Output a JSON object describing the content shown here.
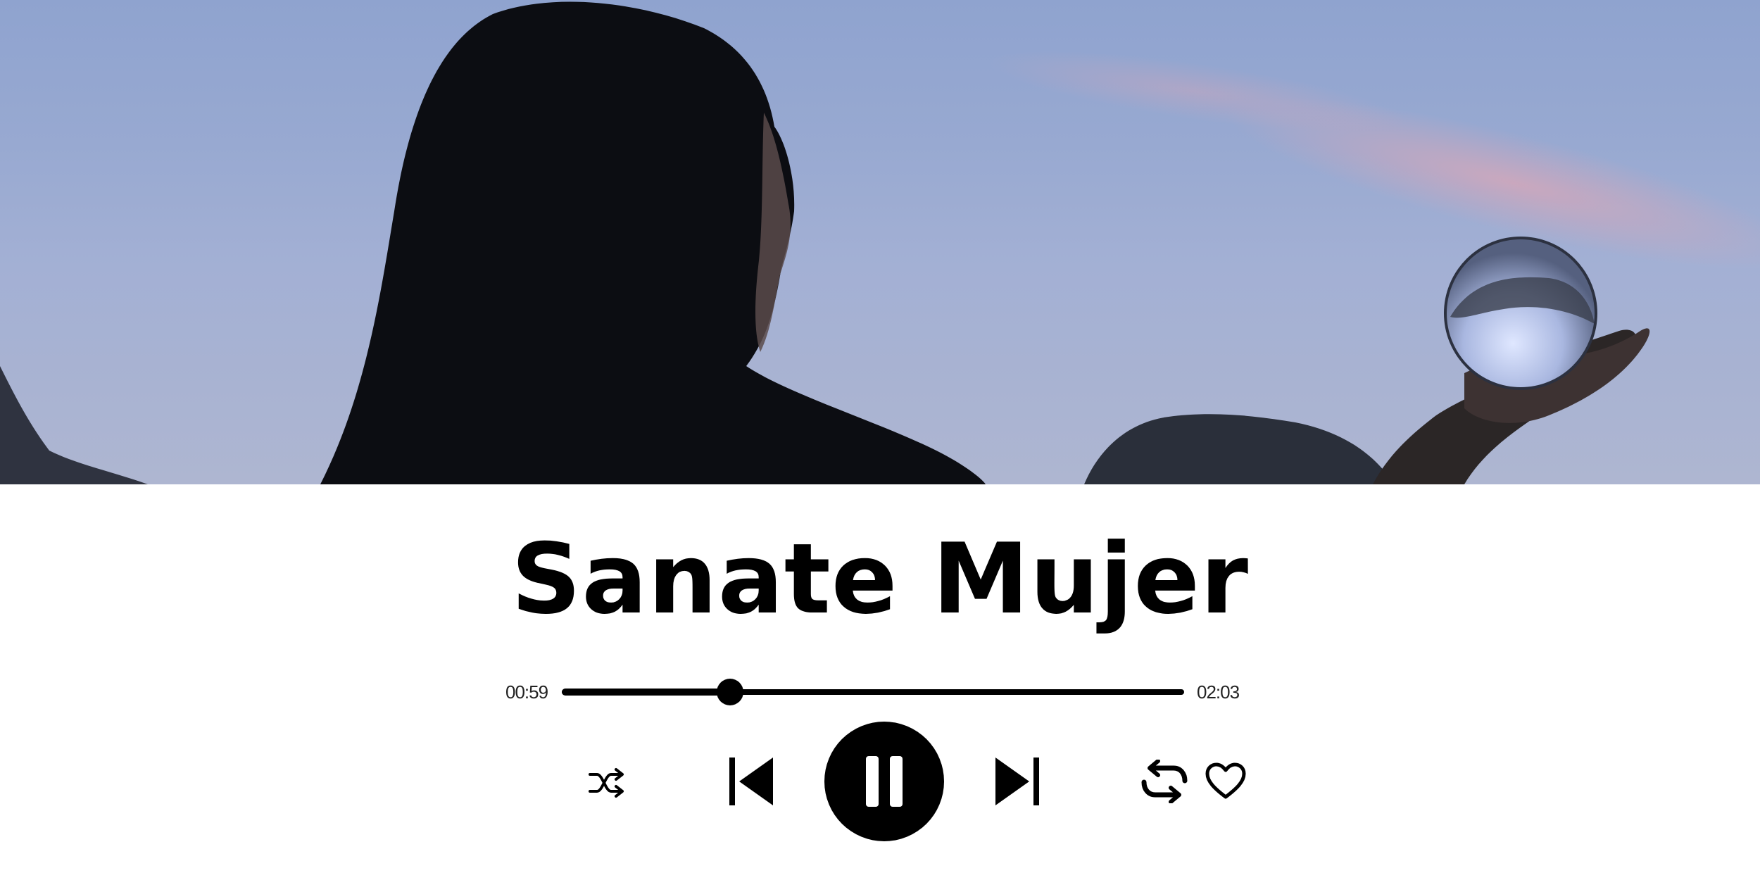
{
  "track": {
    "title": "Sanate Mujer"
  },
  "playback": {
    "elapsed": "00:59",
    "duration": "02:03",
    "progress_percent": 27,
    "state": "playing"
  },
  "controls": {
    "shuffle": "shuffle-icon",
    "previous": "skip-previous-icon",
    "play_pause": "pause-icon",
    "next": "skip-next-icon",
    "repeat": "repeat-icon",
    "like": "heart-icon"
  },
  "colors": {
    "background": "#ffffff",
    "foreground": "#000000",
    "sky": "#98a9d1"
  }
}
